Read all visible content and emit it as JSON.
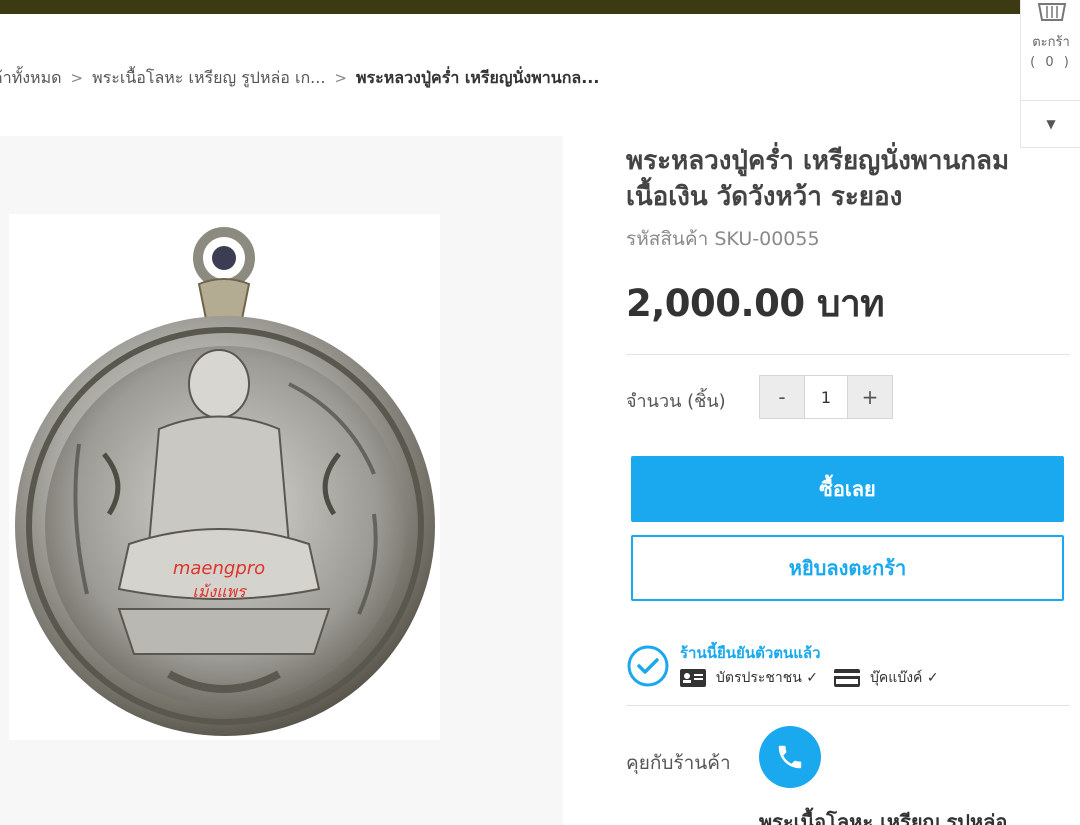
{
  "breadcrumb": {
    "items": [
      "ค้าทั้งหมด",
      "พระเนื้อโลหะ เหรียญ รูปหล่อ เก...",
      "พระหลวงปู่คร่ำ เหรียญนั่งพานกล..."
    ]
  },
  "cart": {
    "label": "ตะกร้า",
    "count": "( 0 )",
    "icon": "basket-icon"
  },
  "product": {
    "title_line1": "พระหลวงปู่คร่ำ เหรียญนั่งพานกลม",
    "title_line2": "เนื้อเงิน วัดวังหว้า ระยอง",
    "sku": "รหัสสินค้า SKU-00055",
    "price": "2,000.00 บาท",
    "image_watermark_1": "maengpro",
    "image_watermark_2": "เม้งแพร"
  },
  "quantity": {
    "label": "จำนวน (ชิ้น)",
    "minus": "-",
    "value": "1",
    "plus": "+"
  },
  "actions": {
    "buy_now": "ซื้อเลย",
    "add_to_cart": "หยิบลงตะกร้า"
  },
  "verification": {
    "text": "ร้านนี้ยืนยันตัวตนแล้ว",
    "id_card": "บัตรประชาชน ✓",
    "bank_book": "บุ๊คแบ๊งค์ ✓"
  },
  "chat": {
    "label": "คุยกับร้านค้า"
  },
  "related": {
    "title": "พระเนื้อโลหะ เหรียญ รูปหล่อ"
  },
  "colors": {
    "accent": "#1aa9ee",
    "topbar": "#3b3a12",
    "image_bg": "#f7f7f7"
  }
}
